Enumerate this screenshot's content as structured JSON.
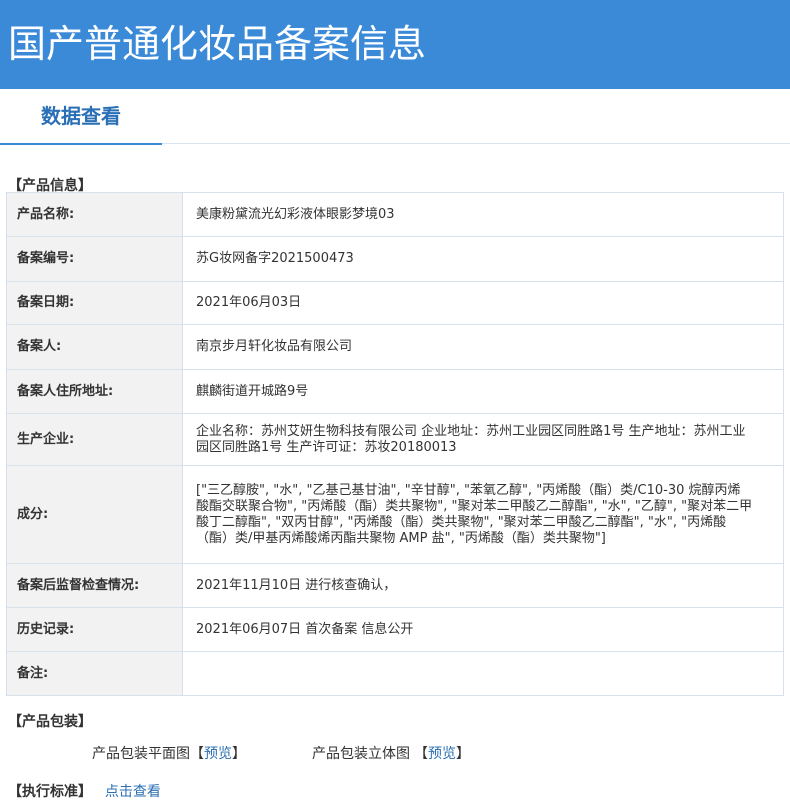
{
  "header": {
    "title": "国产普通化妆品备案信息"
  },
  "tabs": [
    {
      "label": "数据查看"
    }
  ],
  "product_info": {
    "section_title": "【产品信息】",
    "rows": [
      {
        "label": "产品名称:",
        "value": "美康粉黛流光幻彩液体眼影梦境03"
      },
      {
        "label": "备案编号:",
        "value": "苏G妆网备字2021500473"
      },
      {
        "label": "备案日期:",
        "value": "2021年06月03日"
      },
      {
        "label": "备案人:",
        "value": "南京步月轩化妆品有限公司"
      },
      {
        "label": "备案人住所地址:",
        "value": "麒麟街道开城路9号"
      },
      {
        "label": "生产企业:",
        "value": "企业名称：苏州艾妍生物科技有限公司 企业地址：苏州工业园区同胜路1号 生产地址：苏州工业园区同胜路1号 生产许可证：苏妆20180013"
      },
      {
        "label": "成分:",
        "value": "[\"三乙醇胺\", \"水\", \"乙基己基甘油\", \"辛甘醇\", \"苯氧乙醇\", \"丙烯酸（酯）类/C10-30 烷醇丙烯酸酯交联聚合物\", \"丙烯酸（酯）类共聚物\", \"聚对苯二甲酸乙二醇酯\", \"水\", \"乙醇\", \"聚对苯二甲酸丁二醇酯\", \"双丙甘醇\", \"丙烯酸（酯）类共聚物\", \"聚对苯二甲酸乙二醇酯\", \"水\", \"丙烯酸（酯）类/甲基丙烯酸烯丙酯共聚物 AMP 盐\", \"丙烯酸（酯）类共聚物\"]"
      },
      {
        "label": "备案后监督检查情况:",
        "value": "2021年11月10日 进行核查确认，"
      },
      {
        "label": "历史记录:",
        "value": "2021年06月07日 首次备案 信息公开"
      },
      {
        "label": "备注:",
        "value": ""
      }
    ]
  },
  "packaging": {
    "section_title": "【产品包装】",
    "items": [
      {
        "label": "产品包装平面图",
        "bracket_open": "【",
        "link": "预览",
        "bracket_close": "】"
      },
      {
        "label": "产品包装立体图",
        "bracket_open": "【",
        "link": "预览",
        "bracket_close": "】"
      }
    ]
  },
  "standard": {
    "section_title": "【执行标准】",
    "link": "点击查看"
  }
}
